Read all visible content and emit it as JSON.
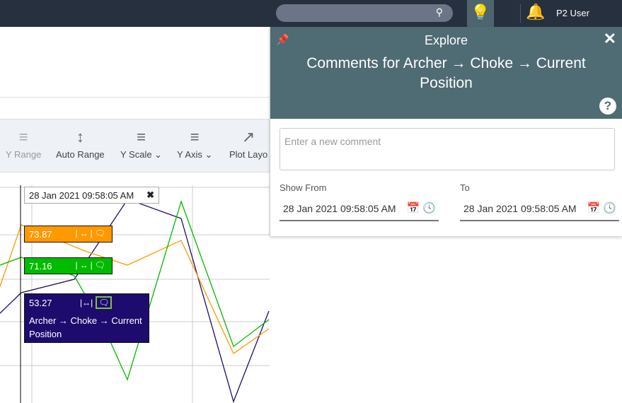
{
  "topbar": {
    "search_placeholder": "",
    "user": "P2 User"
  },
  "toolbar": {
    "items": [
      {
        "label": "Y Range"
      },
      {
        "label": "Auto Range"
      },
      {
        "label": "Y Scale ⌄"
      },
      {
        "label": "Y Axis ⌄"
      },
      {
        "label": "Plot Layo"
      }
    ]
  },
  "chart": {
    "cursor_time": "28 Jan 2021 09:58:05 AM",
    "values": [
      {
        "value": "73.87",
        "color": "#ff9900"
      },
      {
        "value": "71.16",
        "color": "#00bb00"
      },
      {
        "value": "53.27",
        "color": "#1e0b6e",
        "name": "Archer → Choke → Current Position"
      }
    ],
    "colors": {
      "orange": "#ff9900",
      "green": "#00bb00",
      "blue": "#1e0b6e"
    }
  },
  "panel": {
    "label": "Explore",
    "title": "Comments for Archer → Choke → Current Position",
    "comment_placeholder": "Enter a new comment",
    "show_from_label": "Show From",
    "show_from": "28 Jan 2021 09:58:05 AM",
    "to_label": "To",
    "to": "28 Jan 2021 09:58:05 AM"
  }
}
